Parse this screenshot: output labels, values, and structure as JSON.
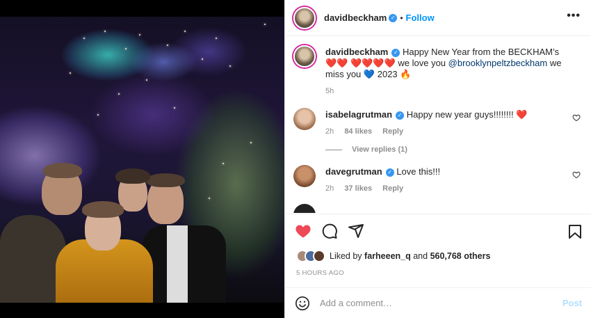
{
  "post": {
    "username": "davidbeckham",
    "follow_label": "Follow",
    "dot": "•",
    "more_label": "•••"
  },
  "caption": {
    "username": "davidbeckham",
    "text_part1": "Happy New Year from the BECKHAM’s",
    "text_part2": "we love you",
    "mention": "@brooklynpeltzbeckham",
    "text_part3": "we miss you",
    "year": "2023",
    "time": "5h",
    "emoji_red_hearts_line1": "❤️❤️",
    "emoji_red_hearts_line2": "❤️❤️❤️❤️",
    "emoji_blue_heart": "💙",
    "emoji_fire": "🔥"
  },
  "comments": [
    {
      "username": "isabelagrutman",
      "text": "Happy new year guys!!!!!!!!",
      "emoji": "❤️",
      "time": "2h",
      "likes": "84 likes",
      "reply": "Reply",
      "avatar_color": "#b68b6a"
    },
    {
      "username": "davegrutman",
      "text": "Love this!!!",
      "time": "2h",
      "likes": "37 likes",
      "reply": "Reply",
      "avatar_color": "#8a5a3a"
    }
  ],
  "view_replies_label": "View replies (1)",
  "liked_by": {
    "prefix": "Liked by",
    "user": "farheeen_q",
    "and": "and",
    "others": "560,768 others"
  },
  "timestamp": "5 HOURS AGO",
  "add_comment": {
    "placeholder": "Add a comment…",
    "post_label": "Post"
  },
  "colors": {
    "accent": "#0095f6",
    "like_red": "#ed4956",
    "post_disabled": "#b2dffc"
  }
}
